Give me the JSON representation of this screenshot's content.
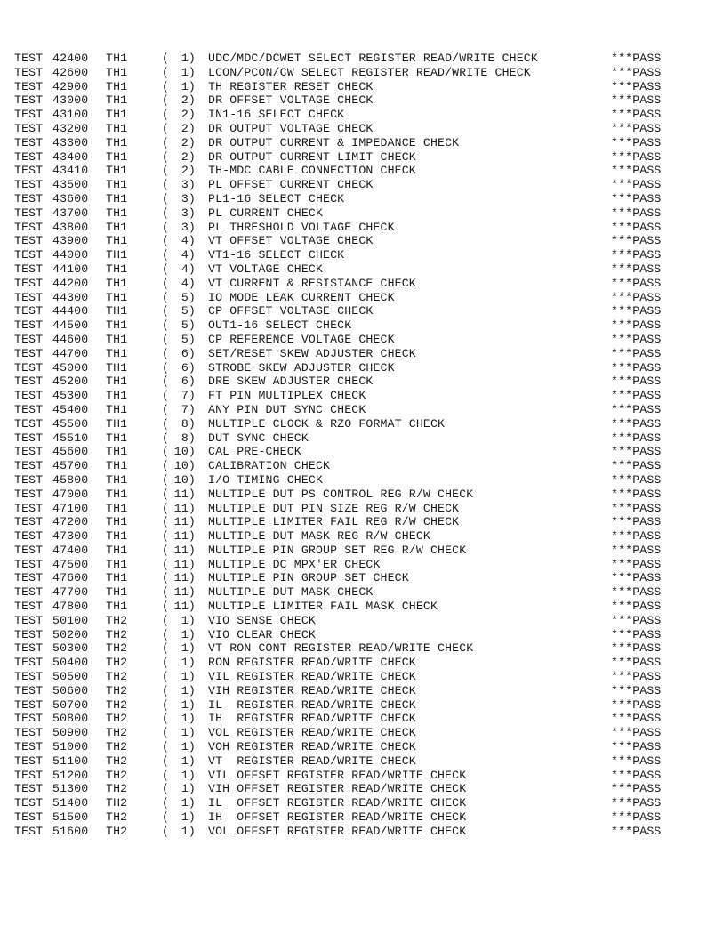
{
  "log": {
    "rows": [
      {
        "prefix": "TEST",
        "test": "42400",
        "head": "TH1",
        "group": "1)",
        "description": "UDC/MDC/DCWET SELECT REGISTER READ/WRITE CHECK",
        "result": "***PASS"
      },
      {
        "prefix": "TEST",
        "test": "42600",
        "head": "TH1",
        "group": "1)",
        "description": "LCON/PCON/CW SELECT REGISTER READ/WRITE CHECK",
        "result": "***PASS"
      },
      {
        "prefix": "TEST",
        "test": "42900",
        "head": "TH1",
        "group": "1)",
        "description": "TH REGISTER RESET CHECK",
        "result": "***PASS"
      },
      {
        "prefix": "TEST",
        "test": "43000",
        "head": "TH1",
        "group": "2)",
        "description": "DR OFFSET VOLTAGE CHECK",
        "result": "***PASS"
      },
      {
        "prefix": "TEST",
        "test": "43100",
        "head": "TH1",
        "group": "2)",
        "description": "IN1-16 SELECT CHECK",
        "result": "***PASS"
      },
      {
        "prefix": "TEST",
        "test": "43200",
        "head": "TH1",
        "group": "2)",
        "description": "DR OUTPUT VOLTAGE CHECK",
        "result": "***PASS"
      },
      {
        "prefix": "TEST",
        "test": "43300",
        "head": "TH1",
        "group": "2)",
        "description": "DR OUTPUT CURRENT & IMPEDANCE CHECK",
        "result": "***PASS"
      },
      {
        "prefix": "TEST",
        "test": "43400",
        "head": "TH1",
        "group": "2)",
        "description": "DR OUTPUT CURRENT LIMIT CHECK",
        "result": "***PASS"
      },
      {
        "prefix": "TEST",
        "test": "43410",
        "head": "TH1",
        "group": "2)",
        "description": "TH-MDC CABLE CONNECTION CHECK",
        "result": "***PASS"
      },
      {
        "prefix": "TEST",
        "test": "43500",
        "head": "TH1",
        "group": "3)",
        "description": "PL OFFSET CURRENT CHECK",
        "result": "***PASS"
      },
      {
        "prefix": "TEST",
        "test": "43600",
        "head": "TH1",
        "group": "3)",
        "description": "PL1-16 SELECT CHECK",
        "result": "***PASS"
      },
      {
        "prefix": "TEST",
        "test": "43700",
        "head": "TH1",
        "group": "3)",
        "description": "PL CURRENT CHECK",
        "result": "***PASS"
      },
      {
        "prefix": "TEST",
        "test": "43800",
        "head": "TH1",
        "group": "3)",
        "description": "PL THRESHOLD VOLTAGE CHECK",
        "result": "***PASS"
      },
      {
        "prefix": "TEST",
        "test": "43900",
        "head": "TH1",
        "group": "4)",
        "description": "VT OFFSET VOLTAGE CHECK",
        "result": "***PASS"
      },
      {
        "prefix": "TEST",
        "test": "44000",
        "head": "TH1",
        "group": "4)",
        "description": "VT1-16 SELECT CHECK",
        "result": "***PASS"
      },
      {
        "prefix": "TEST",
        "test": "44100",
        "head": "TH1",
        "group": "4)",
        "description": "VT VOLTAGE CHECK",
        "result": "***PASS"
      },
      {
        "prefix": "TEST",
        "test": "44200",
        "head": "TH1",
        "group": "4)",
        "description": "VT CURRENT & RESISTANCE CHECK",
        "result": "***PASS"
      },
      {
        "prefix": "TEST",
        "test": "44300",
        "head": "TH1",
        "group": "5)",
        "description": "IO MODE LEAK CURRENT CHECK",
        "result": "***PASS"
      },
      {
        "prefix": "TEST",
        "test": "44400",
        "head": "TH1",
        "group": "5)",
        "description": "CP OFFSET VOLTAGE CHECK",
        "result": "***PASS"
      },
      {
        "prefix": "TEST",
        "test": "44500",
        "head": "TH1",
        "group": "5)",
        "description": "OUT1-16 SELECT CHECK",
        "result": "***PASS"
      },
      {
        "prefix": "TEST",
        "test": "44600",
        "head": "TH1",
        "group": "5)",
        "description": "CP REFERENCE VOLTAGE CHECK",
        "result": "***PASS"
      },
      {
        "prefix": "TEST",
        "test": "44700",
        "head": "TH1",
        "group": "6)",
        "description": "SET/RESET SKEW ADJUSTER CHECK",
        "result": "***PASS"
      },
      {
        "prefix": "TEST",
        "test": "45000",
        "head": "TH1",
        "group": "6)",
        "description": "STROBE SKEW ADJUSTER CHECK",
        "result": "***PASS"
      },
      {
        "prefix": "TEST",
        "test": "45200",
        "head": "TH1",
        "group": "6)",
        "description": "DRE SKEW ADJUSTER CHECK",
        "result": "***PASS"
      },
      {
        "prefix": "TEST",
        "test": "45300",
        "head": "TH1",
        "group": "7)",
        "description": "FT PIN MULTIPLEX CHECK",
        "result": "***PASS"
      },
      {
        "prefix": "TEST",
        "test": "45400",
        "head": "TH1",
        "group": "7)",
        "description": "ANY PIN DUT SYNC CHECK",
        "result": "***PASS"
      },
      {
        "prefix": "TEST",
        "test": "45500",
        "head": "TH1",
        "group": "8)",
        "description": "MULTIPLE CLOCK & RZO FORMAT CHECK",
        "result": "***PASS"
      },
      {
        "prefix": "TEST",
        "test": "45510",
        "head": "TH1",
        "group": "8)",
        "description": "DUT SYNC CHECK",
        "result": "***PASS"
      },
      {
        "prefix": "TEST",
        "test": "45600",
        "head": "TH1",
        "group": "10)",
        "description": "CAL PRE-CHECK",
        "result": "***PASS"
      },
      {
        "prefix": "TEST",
        "test": "45700",
        "head": "TH1",
        "group": "10)",
        "description": "CALIBRATION CHECK",
        "result": "***PASS"
      },
      {
        "prefix": "TEST",
        "test": "45800",
        "head": "TH1",
        "group": "10)",
        "description": "I/O TIMING CHECK",
        "result": "***PASS"
      },
      {
        "prefix": "TEST",
        "test": "47000",
        "head": "TH1",
        "group": "11)",
        "description": "MULTIPLE DUT PS CONTROL REG R/W CHECK",
        "result": "***PASS"
      },
      {
        "prefix": "TEST",
        "test": "47100",
        "head": "TH1",
        "group": "11)",
        "description": "MULTIPLE DUT PIN SIZE REG R/W CHECK",
        "result": "***PASS"
      },
      {
        "prefix": "TEST",
        "test": "47200",
        "head": "TH1",
        "group": "11)",
        "description": "MULTIPLE LIMITER FAIL REG R/W CHECK",
        "result": "***PASS"
      },
      {
        "prefix": "TEST",
        "test": "47300",
        "head": "TH1",
        "group": "11)",
        "description": "MULTIPLE DUT MASK REG R/W CHECK",
        "result": "***PASS"
      },
      {
        "prefix": "TEST",
        "test": "47400",
        "head": "TH1",
        "group": "11)",
        "description": "MULTIPLE PIN GROUP SET REG R/W CHECK",
        "result": "***PASS"
      },
      {
        "prefix": "TEST",
        "test": "47500",
        "head": "TH1",
        "group": "11)",
        "description": "MULTIPLE DC MPX'ER CHECK",
        "result": "***PASS"
      },
      {
        "prefix": "TEST",
        "test": "47600",
        "head": "TH1",
        "group": "11)",
        "description": "MULTIPLE PIN GROUP SET CHECK",
        "result": "***PASS"
      },
      {
        "prefix": "TEST",
        "test": "47700",
        "head": "TH1",
        "group": "11)",
        "description": "MULTIPLE DUT MASK CHECK",
        "result": "***PASS"
      },
      {
        "prefix": "TEST",
        "test": "47800",
        "head": "TH1",
        "group": "11)",
        "description": "MULTIPLE LIMITER FAIL MASK CHECK",
        "result": "***PASS"
      },
      {
        "prefix": "TEST",
        "test": "50100",
        "head": "TH2",
        "group": "1)",
        "description": "VIO SENSE CHECK",
        "result": "***PASS"
      },
      {
        "prefix": "TEST",
        "test": "50200",
        "head": "TH2",
        "group": "1)",
        "description": "VIO CLEAR CHECK",
        "result": "***PASS"
      },
      {
        "prefix": "TEST",
        "test": "50300",
        "head": "TH2",
        "group": "1)",
        "description": "VT RON CONT REGISTER READ/WRITE CHECK",
        "result": "***PASS"
      },
      {
        "prefix": "TEST",
        "test": "50400",
        "head": "TH2",
        "group": "1)",
        "description": "RON REGISTER READ/WRITE CHECK",
        "result": "***PASS"
      },
      {
        "prefix": "TEST",
        "test": "50500",
        "head": "TH2",
        "group": "1)",
        "description": "VIL REGISTER READ/WRITE CHECK",
        "result": "***PASS"
      },
      {
        "prefix": "TEST",
        "test": "50600",
        "head": "TH2",
        "group": "1)",
        "description": "VIH REGISTER READ/WRITE CHECK",
        "result": "***PASS"
      },
      {
        "prefix": "TEST",
        "test": "50700",
        "head": "TH2",
        "group": "1)",
        "description": "IL  REGISTER READ/WRITE CHECK",
        "result": "***PASS"
      },
      {
        "prefix": "TEST",
        "test": "50800",
        "head": "TH2",
        "group": "1)",
        "description": "IH  REGISTER READ/WRITE CHECK",
        "result": "***PASS"
      },
      {
        "prefix": "TEST",
        "test": "50900",
        "head": "TH2",
        "group": "1)",
        "description": "VOL REGISTER READ/WRITE CHECK",
        "result": "***PASS"
      },
      {
        "prefix": "TEST",
        "test": "51000",
        "head": "TH2",
        "group": "1)",
        "description": "VOH REGISTER READ/WRITE CHECK",
        "result": "***PASS"
      },
      {
        "prefix": "TEST",
        "test": "51100",
        "head": "TH2",
        "group": "1)",
        "description": "VT  REGISTER READ/WRITE CHECK",
        "result": "***PASS"
      },
      {
        "prefix": "TEST",
        "test": "51200",
        "head": "TH2",
        "group": "1)",
        "description": "VIL OFFSET REGISTER READ/WRITE CHECK",
        "result": "***PASS"
      },
      {
        "prefix": "TEST",
        "test": "51300",
        "head": "TH2",
        "group": "1)",
        "description": "VIH OFFSET REGISTER READ/WRITE CHECK",
        "result": "***PASS"
      },
      {
        "prefix": "TEST",
        "test": "51400",
        "head": "TH2",
        "group": "1)",
        "description": "IL  OFFSET REGISTER READ/WRITE CHECK",
        "result": "***PASS"
      },
      {
        "prefix": "TEST",
        "test": "51500",
        "head": "TH2",
        "group": "1)",
        "description": "IH  OFFSET REGISTER READ/WRITE CHECK",
        "result": "***PASS"
      },
      {
        "prefix": "TEST",
        "test": "51600",
        "head": "TH2",
        "group": "1)",
        "description": "VOL OFFSET REGISTER READ/WRITE CHECK",
        "result": "***PASS"
      }
    ]
  }
}
